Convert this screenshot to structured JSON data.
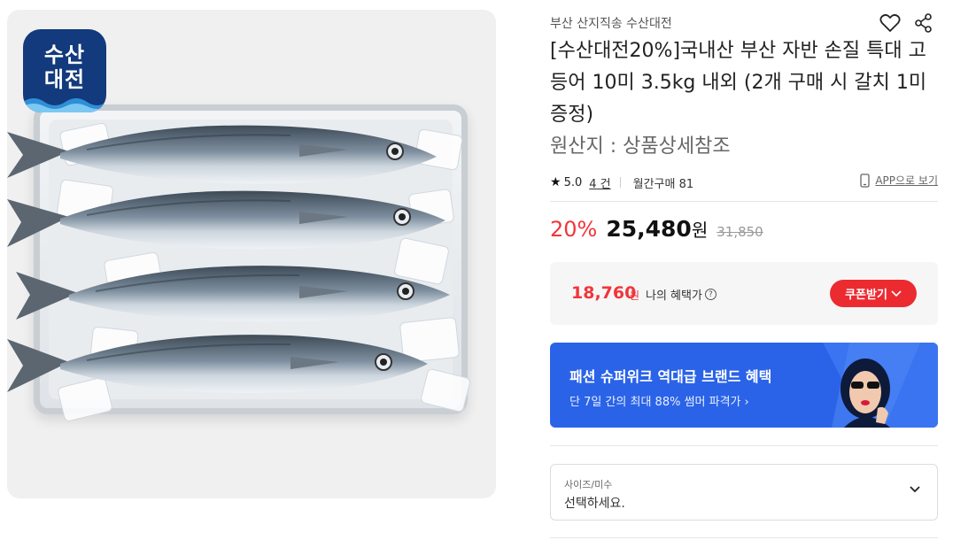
{
  "brand_badge": {
    "line1": "수산",
    "line2": "대전"
  },
  "product": {
    "seller": "부산 산지직송 수산대전",
    "title": "[수산대전20%]국내산 부산 자반 손질 특대 고등어 10미 3.5kg 내외 (2개 구매 시 갈치 1미 증정)",
    "origin": "원산지 : 상품상세참조",
    "rating": "5.0",
    "review_count": "4 건",
    "monthly_purchase": "월간구매 81",
    "app_link": "APP으로 보기"
  },
  "price": {
    "discount": "20%",
    "sale_price": "25,480",
    "currency": "원",
    "original_price": "31,850"
  },
  "benefit": {
    "price": "18,760",
    "currency": "원",
    "label": "나의 혜택가",
    "coupon_button": "쿠폰받기"
  },
  "banner": {
    "title": "패션 슈퍼위크 역대급 브랜드 혜택",
    "subtitle": "단 7일 간의 최대 88% 썸머 파격가"
  },
  "option_select": {
    "label": "사이즈/미수",
    "value": "선택하세요."
  },
  "colors": {
    "accent_red": "#f2353a",
    "banner_blue": "#2a63e8",
    "badge_navy": "#123a7c"
  },
  "icons": {
    "wishlist": "heart-icon",
    "share": "share-icon",
    "rating": "star-icon",
    "app": "mobile-phone-icon",
    "help": "question-circle-icon",
    "dropdown": "chevron-down-icon"
  }
}
